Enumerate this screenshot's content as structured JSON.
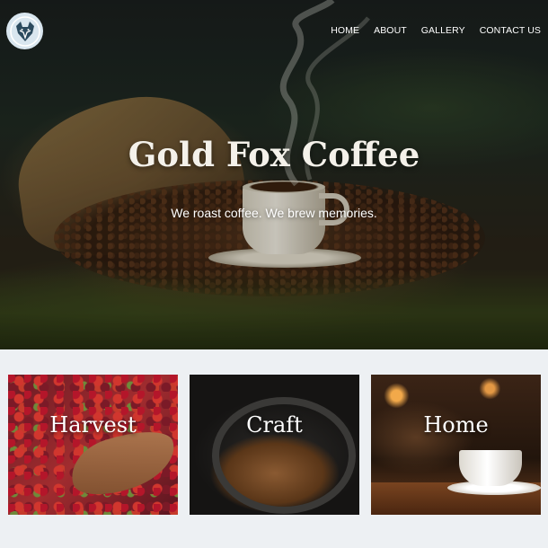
{
  "brand": {
    "logo_icon": "fox-icon"
  },
  "nav": {
    "items": [
      {
        "label": "HOME"
      },
      {
        "label": "ABOUT"
      },
      {
        "label": "GALLERY"
      },
      {
        "label": "CONTACT US"
      }
    ]
  },
  "hero": {
    "title": "Gold Fox Coffee",
    "tagline": "We roast coffee. We brew memories."
  },
  "cards": [
    {
      "label": "Harvest"
    },
    {
      "label": "Craft"
    },
    {
      "label": "Home"
    }
  ],
  "colors": {
    "page_background": "#edf0f3",
    "nav_text": "#ffffff",
    "title_text": "#f4f1ea"
  }
}
